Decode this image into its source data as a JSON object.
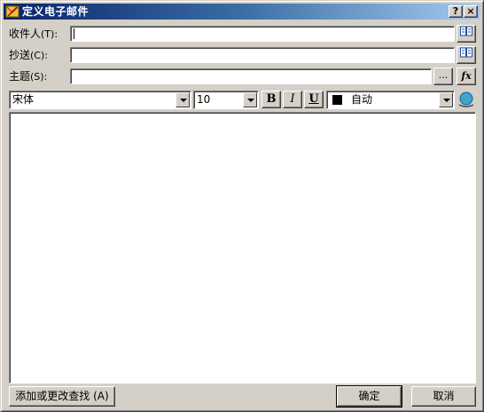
{
  "window": {
    "title": "定义电子邮件",
    "help_button": "?",
    "close_button": "×"
  },
  "fields": {
    "to": {
      "label": "收件人",
      "hotkey": "(T):",
      "value": ""
    },
    "cc": {
      "label": "抄送",
      "hotkey": "(C):",
      "value": ""
    },
    "subject": {
      "label": "主题",
      "hotkey": "(S):",
      "value": ""
    }
  },
  "buttons": {
    "ellipsis": "...",
    "fx": "fx",
    "bold": "B",
    "italic": "I",
    "underline": "U",
    "add_or_change_lookup": "添加或更改查找 (A)",
    "ok": "确定",
    "cancel": "取消"
  },
  "format": {
    "font": "宋体",
    "size": "10",
    "color_label": "自动",
    "color_swatch": "#000000"
  },
  "body_text": "",
  "icons": {
    "address_book": "address-book-icon",
    "web_link": "globe-link-icon",
    "app": "email-app-icon"
  }
}
